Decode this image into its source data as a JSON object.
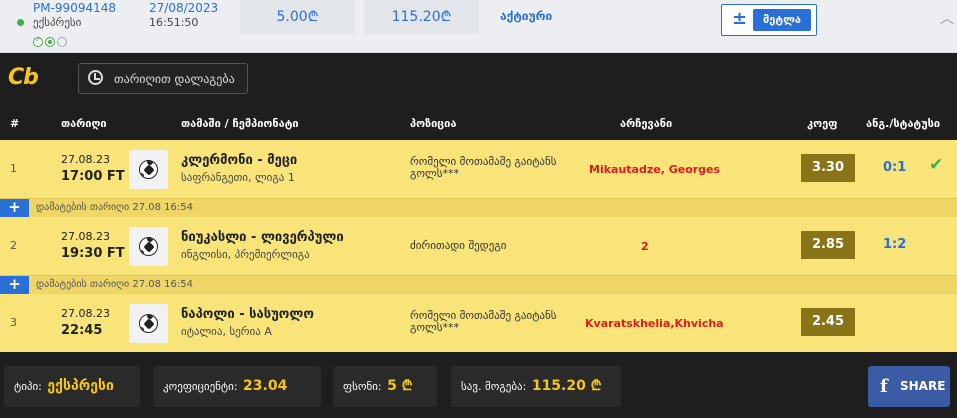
{
  "ticket": {
    "id": "PM-99094148",
    "type_label": "ექსპრესი",
    "date": "27/08/2023",
    "time": "16:51:50",
    "stake": "5.00₾",
    "payout": "115.20₾",
    "status": "აქტიური",
    "repeat_label": "მეტლა",
    "repeat_icon": "plus-icon",
    "expand_icon": "chevron-up-icon"
  },
  "brand": {
    "logo_text": "Cb"
  },
  "date_filter": {
    "label": "თარიღით დალაგება",
    "icon": "clock-icon"
  },
  "columns": {
    "num": "#",
    "date": "თარიღი",
    "event": "თამაში / ჩემპიონატი",
    "market": "პოზიცია",
    "pick": "არჩევანი",
    "odds": "კოეფ",
    "result": "ანგ./სტატუსი"
  },
  "rows": [
    {
      "num": "1",
      "date": "27.08.23",
      "time": "17:00 FT",
      "match": "კლერმონი - მეცი",
      "league": "საფრანგეთი, ლიგა 1",
      "market": "რომელი მოთამაშე გაიტანს გოლს***",
      "pick": "Mikautadze, Georges",
      "odds": "3.30",
      "result": "0:1",
      "status_icon": "check-icon"
    },
    {
      "num": "2",
      "date": "27.08.23",
      "time": "19:30 FT",
      "match": "ნიუკასლი - ლივერპული",
      "league": "ინგლისი, პრემიერლიგა",
      "market": "ძირითადი შედეგი",
      "pick": "2",
      "odds": "2.85",
      "result": "1:2"
    },
    {
      "num": "3",
      "date": "27.08.23",
      "time": "22:45",
      "match": "ნაპოლი - სასუოლო",
      "league": "იტალია, სერია A",
      "market": "რომელი მოთამაშე გაიტანს გოლს***",
      "pick": "Kvaratskhelia,Khvicha",
      "odds": "2.45",
      "result": ""
    }
  ],
  "added_notes": [
    "დამატების თარიღი 27.08 16:54",
    "დამატების თარიღი 27.08 16:54"
  ],
  "footer": {
    "type_label": "ტიპი:",
    "type_value": "ექსპრესი",
    "coef_label": "კოეფიციენტი:",
    "coef_value": "23.04",
    "stake_label": "ფსონი:",
    "stake_value": "5 ₾",
    "payout_label": "სავ. მოგება:",
    "payout_value": "115.20 ₾",
    "share_label": "SHARE",
    "share_icon": "facebook-icon"
  },
  "colors": {
    "accent_blue": "#2a6fd6",
    "row_yellow": "#f8e478",
    "odds_bg": "#8a7418",
    "pick_red": "#e01b1b",
    "brand_yellow": "#f5c518",
    "win_green": "#3cb043",
    "facebook_blue": "#3b5ba5"
  }
}
